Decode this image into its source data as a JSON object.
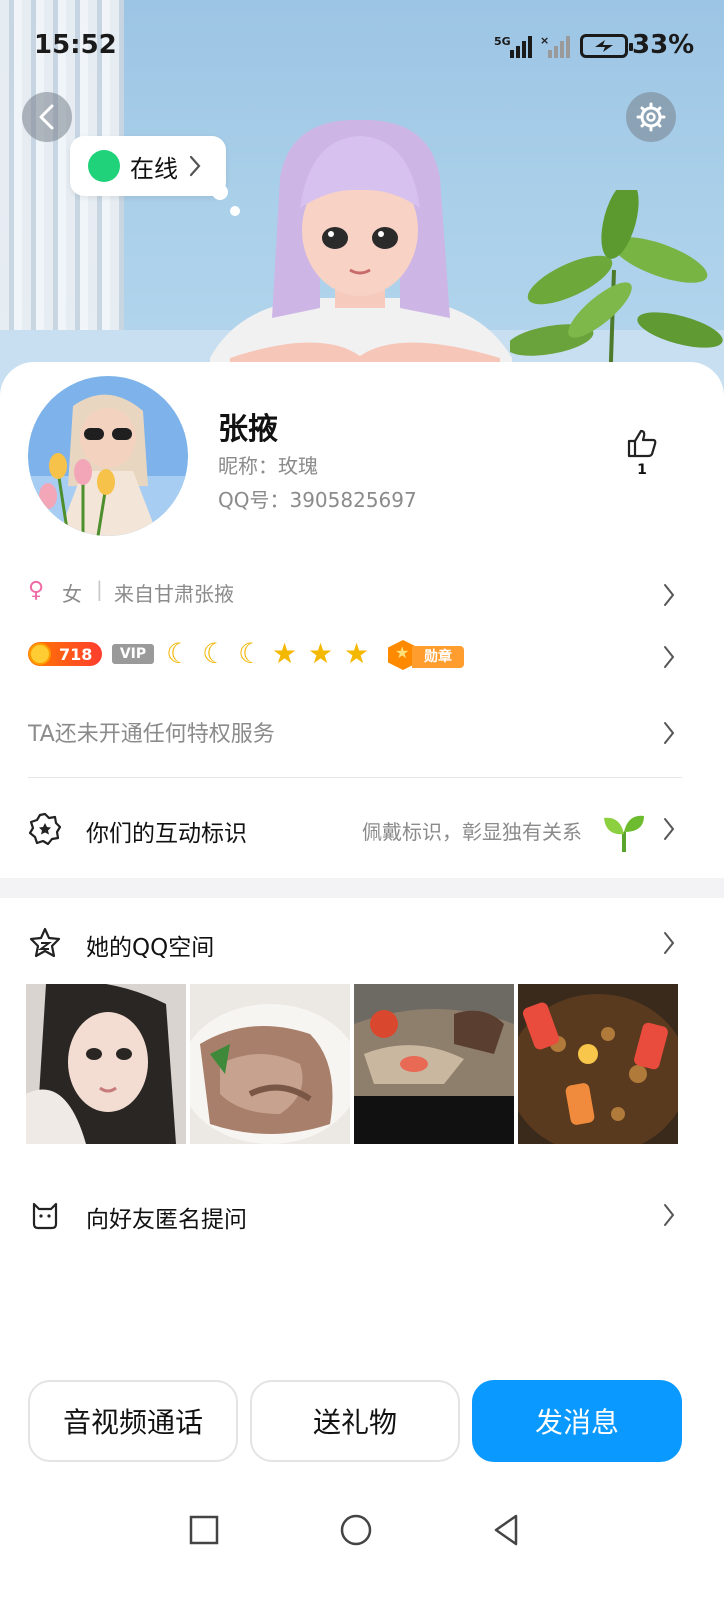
{
  "status_bar": {
    "time": "15:52",
    "network": "5G",
    "battery": "33%"
  },
  "header": {
    "back_icon": "chevron-left-icon",
    "settings_icon": "gear-icon",
    "online_status": "在线"
  },
  "profile": {
    "name": "张掖",
    "nickname": "昵称：玫瑰",
    "qq_number": "QQ号：3905825697",
    "likes": "1"
  },
  "details": {
    "gender": "女",
    "gender_symbol": "♀",
    "separator": "|",
    "hometown": "来自甘肃张掖"
  },
  "badges": {
    "level": "718",
    "vip_label": "VIP",
    "medal_label": "勋章"
  },
  "privilege_text": "TA还未开通任何特权服务",
  "interaction": {
    "title": "你们的互动标识",
    "hint": "佩戴标识，彰显独有关系"
  },
  "qzone": {
    "title": "她的QQ空间"
  },
  "anonymous_question": {
    "title": "向好友匿名提问"
  },
  "actions": {
    "call": "音视频通话",
    "gift": "送礼物",
    "message": "发消息"
  },
  "colors": {
    "primary": "#0a99ff",
    "online": "#20d27a",
    "female": "#f06aa6"
  }
}
